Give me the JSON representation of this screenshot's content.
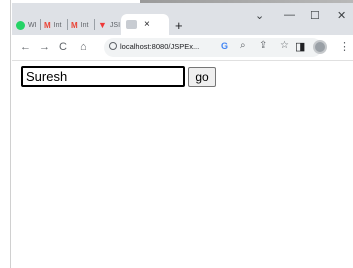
{
  "browser": {
    "tabs": [
      {
        "label": "WI",
        "icon": "whatsapp-icon"
      },
      {
        "label": "Int",
        "icon": "gmail-icon"
      },
      {
        "label": "Int",
        "icon": "gmail-icon"
      },
      {
        "label": "JSI",
        "icon": "vivaldi-icon"
      },
      {
        "label": "",
        "icon": "jsp-page-icon",
        "active": true
      }
    ],
    "new_tab_symbol": "+",
    "close_symbol": "×",
    "window_controls": {
      "dropdown": "⌄",
      "minimize": "—",
      "maximize": "☐",
      "close": "✕"
    },
    "nav": {
      "back": "←",
      "forward": "→",
      "reload": "C",
      "home": "⌂"
    },
    "url": "localhost:8080/JSPEx...",
    "toolbar_icons": {
      "google": "G",
      "zoom": "⌕",
      "share": "⇪",
      "bookmark": "☆",
      "sidepanel": "◨",
      "menu": "⋮"
    }
  },
  "form": {
    "name_value": "Suresh",
    "go_label": "go"
  },
  "colors": {
    "tabbar_bg": "#dee1e6",
    "omnibox_bg": "#f1f3f4",
    "whatsapp": "#25d366",
    "gmail": "#ea4335",
    "vivaldi": "#ef3939"
  }
}
